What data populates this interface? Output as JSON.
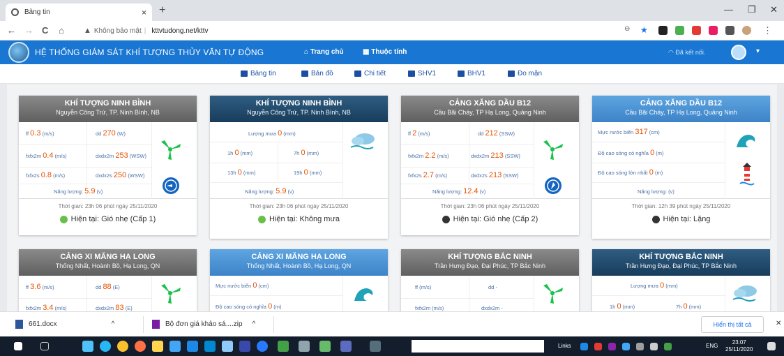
{
  "browser": {
    "tab_title": "Bảng tin",
    "tab_close": "×",
    "new_tab": "+",
    "back": "←",
    "forward": "→",
    "reload": "C",
    "home": "⌂",
    "security": "Không bảo mật",
    "url": "kttvtudong.net/kttv",
    "window_min": "—",
    "window_max": "❐",
    "window_close": "✕"
  },
  "app": {
    "title": "HỆ THỐNG GIÁM SÁT KHÍ TƯỢNG THỦY VĂN TỰ ĐỘNG",
    "nav_home": "Trang chủ",
    "nav_props": "Thuộc tính",
    "connection": "Đã kết nối.",
    "caret": "▾"
  },
  "subnav": [
    "Bảng tin",
    "Bản đồ",
    "Chi tiết",
    "SHV1",
    "BHV1",
    "Đo mặn"
  ],
  "cards": [
    {
      "title": "KHÍ TƯỢNG NINH BÌNH",
      "subtitle": "Nguyễn Công Trứ, TP. Ninh Bình, NB",
      "ff_l": "ff",
      "ff": "0.3",
      "ff_u": "(m/s)",
      "dd_l": "dd",
      "dd": "270",
      "dd_u": "(W)",
      "fx2m_l": "fxfx2m",
      "fx2m": "0.4",
      "fx2m_u": "(m/s)",
      "dx2m_l": "dxdx2m",
      "dx2m": "253",
      "dx2m_u": "(WSW)",
      "fx2s_l": "fxfx2s",
      "fx2s": "0.8",
      "fx2s_u": "(m/s)",
      "dx2s_l": "dxdx2s",
      "dx2s": "250",
      "dx2s_u": "(WSW)",
      "energy_l": "Năng lượng:",
      "energy": "5.9",
      "energy_u": "(v)",
      "time": "Thời gian: 23h 06 phút ngày 25/11/2020",
      "status": "Hiện tại: Gió nhẹ (Cấp 1)"
    },
    {
      "title": "KHÍ TƯỢNG NINH BÌNH",
      "subtitle": "Nguyễn Công Trứ, TP. Ninh Bình, NB",
      "rain_l": "Lượng mưa",
      "rain": "0",
      "rain_u": "(mm)",
      "r1h_l": "1h",
      "r1h": "0",
      "r1h_u": "(mm)",
      "r7h_l": "7h",
      "r7h": "0",
      "r7h_u": "(mm)",
      "r13h_l": "13h",
      "r13h": "0",
      "r13h_u": "(mm)",
      "r19h_l": "19h",
      "r19h": "0",
      "r19h_u": "(mm)",
      "energy_l": "Năng lượng:",
      "energy": "5.9",
      "energy_u": "(v)",
      "time": "Thời gian: 23h 06 phút ngày 25/11/2020",
      "status": "Hiện tại: Không mưa"
    },
    {
      "title": "CẢNG XĂNG DẦU B12",
      "subtitle": "Cầu Bãi Cháy, TP Hạ Long, Quảng Ninh",
      "ff_l": "ff",
      "ff": "2",
      "ff_u": "(m/s)",
      "dd_l": "dd",
      "dd": "212",
      "dd_u": "(SSW)",
      "fx2m_l": "fxfx2m",
      "fx2m": "2.2",
      "fx2m_u": "(m/s)",
      "dx2m_l": "dxdx2m",
      "dx2m": "213",
      "dx2m_u": "(SSW)",
      "fx2s_l": "fxfx2s",
      "fx2s": "2.7",
      "fx2s_u": "(m/s)",
      "dx2s_l": "dxdx2s",
      "dx2s": "213",
      "dx2s_u": "(SSW)",
      "energy_l": "Năng lượng:",
      "energy": "12.4",
      "energy_u": "(v)",
      "time": "Thời gian: 23h 06 phút ngày 25/11/2020",
      "status": "Hiện tại: Gió nhẹ (Cấp 2)"
    },
    {
      "title": "CẢNG XĂNG DẦU B12",
      "subtitle": "Cầu Bãi Cháy, TP Hạ Long, Quảng Ninh",
      "sea_l": "Mực nước biển",
      "sea": "317",
      "sea_u": "(cm)",
      "wave_s_l": "Độ cao sóng có nghĩa",
      "wave_s": "0",
      "wave_s_u": "(m)",
      "wave_m_l": "Độ cao sóng lớn nhất",
      "wave_m": "0",
      "wave_m_u": "(m)",
      "energy_l": "Năng lượng:",
      "energy_u": "(v)",
      "time": "Thời gian: 12h 39 phút ngày 25/11/2020",
      "status": "Hiện tại: Lặng"
    },
    {
      "title": "CẢNG XI MĂNG HẠ LONG",
      "subtitle": "Thống Nhất, Hoành Bồ, Hạ Long, QN",
      "ff_l": "ff",
      "ff": "3.6",
      "ff_u": "(m/s)",
      "dd_l": "dd",
      "dd": "88",
      "dd_u": "(E)",
      "fx2m_l": "fxfx2m",
      "fx2m": "3.4",
      "fx2m_u": "(m/s)",
      "dx2m_l": "dxdx2m",
      "dx2m": "83",
      "dx2m_u": "(E)"
    },
    {
      "title": "CẢNG XI MĂNG HẠ LONG",
      "subtitle": "Thống Nhất, Hoành Bồ, Hạ Long, QN",
      "sea_l": "Mực nước biển",
      "sea": "0",
      "sea_u": "(cm)",
      "wave_s_l": "Độ cao sóng có nghĩa",
      "wave_s": "0",
      "wave_s_u": "(m)"
    },
    {
      "title": "KHÍ TƯỢNG BẮC NINH",
      "subtitle": "Trần Hưng Đạo, Đại Phúc, TP Bắc Ninh",
      "ff_l": "ff",
      "ff_u": "(m/s)",
      "dd_l": "dd",
      "dd_val": "-",
      "fx2m_l": "fxfx2m",
      "fx2m_u": "(m/s)",
      "dx2m_l": "dxdx2m",
      "dx2m_val": "-"
    },
    {
      "title": "KHÍ TƯỢNG BẮC NINH",
      "subtitle": "Trần Hưng Đạo, Đại Phúc, TP Bắc Ninh",
      "rain_l": "Lượng mưa",
      "rain": "0",
      "rain_u": "(mm)",
      "r1h_l": "1h",
      "r1h": "0",
      "r1h_u": "(mm)",
      "r7h_l": "7h",
      "r7h": "0",
      "r7h_u": "(mm)"
    }
  ],
  "downloads": {
    "file1": "661.docx",
    "file2": "Bộ đơn giá khảo sá....zip",
    "chevron": "^",
    "show_all": "Hiển thị tất cả",
    "close": "✕"
  },
  "taskbar": {
    "links": "Links",
    "lang": "ENG",
    "time": "23:07",
    "date": "25/11/2020"
  },
  "colors": {
    "appbar": "#1976d2",
    "value": "#e65100",
    "label": "#4a6fa5",
    "fan": "#19c24a",
    "status_green": "#6abf4b",
    "status_dark": "#333333"
  }
}
